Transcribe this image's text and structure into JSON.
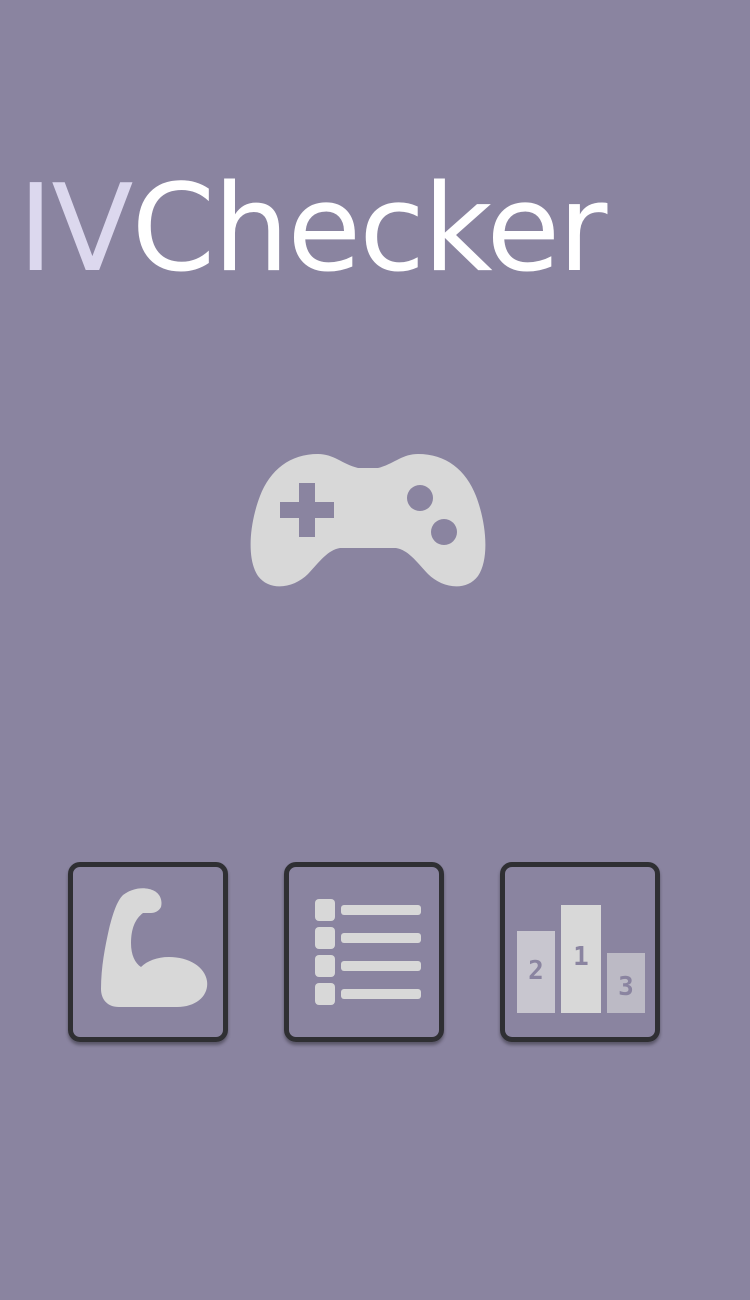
{
  "app": {
    "title_prefix": "IV",
    "title_suffix": "Checker"
  },
  "icons": {
    "main": "gamepad-icon",
    "menu": [
      "flexed-arm-icon",
      "list-icon",
      "podium-icon"
    ]
  },
  "podium_labels": [
    "2",
    "1",
    "3"
  ],
  "colors": {
    "background": "#8a84a0",
    "title_prefix": "#dcd8ee",
    "title_suffix": "#ffffff",
    "icon_fill": "#d8d8d8",
    "tile_border": "#2f2f33"
  }
}
